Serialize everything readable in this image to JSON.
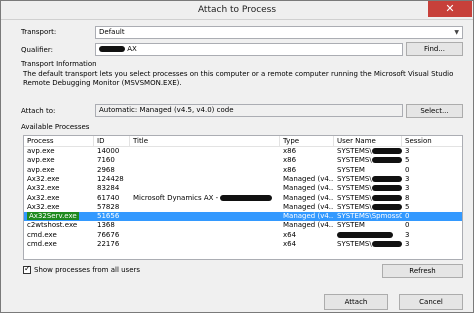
{
  "window": {
    "title": "Attach to Process",
    "close_glyph": "✕"
  },
  "transport": {
    "label": "Transport:",
    "value": "Default"
  },
  "qualifier": {
    "label": "Qualifier:",
    "value_suffix": "AX",
    "find_button": "Find..."
  },
  "transport_info": {
    "heading": "Transport Information",
    "text": "The default transport lets you select processes on this computer or a remote computer running the Microsoft Visual Studio Remote Debugging Monitor (MSVSMON.EXE)."
  },
  "attach_to": {
    "label": "Attach to:",
    "value": "Automatic: Managed (v4.5, v4.0) code",
    "select_button": "Select..."
  },
  "processes": {
    "heading": "Available Processes",
    "columns": [
      "Process",
      "ID",
      "Title",
      "Type",
      "User Name",
      "Session"
    ],
    "rows": [
      {
        "process": "avp.exe",
        "id": "14000",
        "title": "",
        "type": "x86",
        "user": "SYSTEMS\\",
        "session": "3",
        "selected": false
      },
      {
        "process": "avp.exe",
        "id": "7160",
        "title": "",
        "type": "x86",
        "user": "SYSTEMS\\",
        "session": "5",
        "selected": false
      },
      {
        "process": "avp.exe",
        "id": "2968",
        "title": "",
        "type": "x86",
        "user": "SYSTEM",
        "session": "0",
        "selected": false
      },
      {
        "process": "Ax32.exe",
        "id": "124428",
        "title": "",
        "type": "Managed (v4....",
        "user": "SYSTEMS\\",
        "session": "3",
        "selected": false
      },
      {
        "process": "Ax32.exe",
        "id": "83284",
        "title": "",
        "type": "Managed (v4....",
        "user": "SYSTEMS\\",
        "session": "3",
        "selected": false
      },
      {
        "process": "Ax32.exe",
        "id": "61740",
        "title": "Microsoft Dynamics AX -",
        "type": "Managed (v4....",
        "user": "SYSTEMS\\",
        "session": "8",
        "selected": false
      },
      {
        "process": "Ax32.exe",
        "id": "57828",
        "title": "",
        "type": "Managed (v4....",
        "user": "SYSTEMS\\",
        "session": "5",
        "selected": false
      },
      {
        "process": "Ax32Serv.exe",
        "id": "51656",
        "title": "",
        "type": "Managed (v4....",
        "user": "SYSTEMS\\Spmoss07",
        "session": "0",
        "selected": true
      },
      {
        "process": "c2wtshost.exe",
        "id": "1368",
        "title": "",
        "type": "Managed (v4....",
        "user": "SYSTEM",
        "session": "0",
        "selected": false
      },
      {
        "process": "cmd.exe",
        "id": "76676",
        "title": "",
        "type": "x64",
        "user": "",
        "session": "3",
        "selected": false
      },
      {
        "process": "cmd.exe",
        "id": "22176",
        "title": "",
        "type": "x64",
        "user": "SYSTEMS\\",
        "session": "3",
        "selected": false
      }
    ]
  },
  "show_all": {
    "label": "Show processes from all users",
    "checked": true
  },
  "buttons": {
    "refresh": "Refresh",
    "attach": "Attach",
    "cancel": "Cancel"
  }
}
